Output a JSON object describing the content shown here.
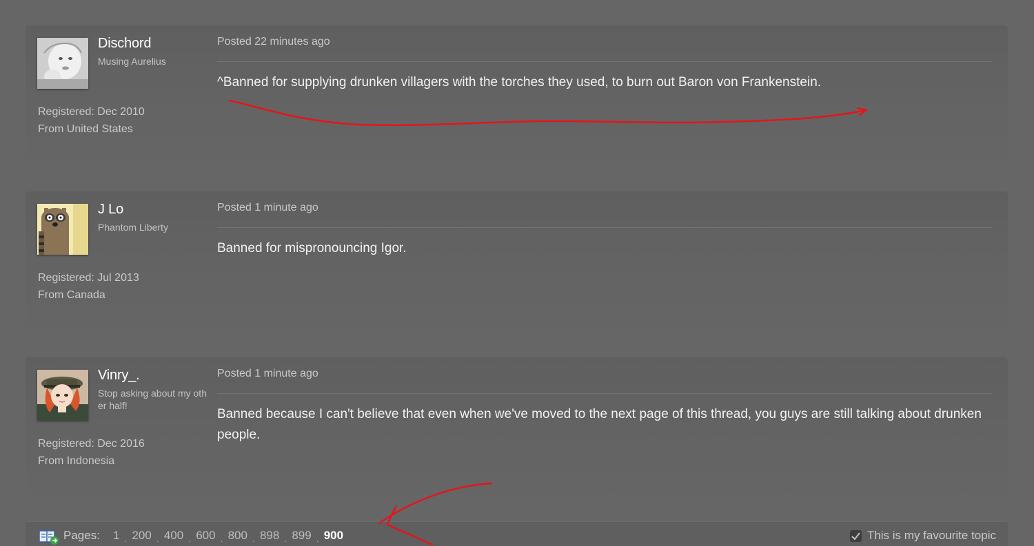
{
  "posts": [
    {
      "username": "Dischord",
      "user_title": "Musing Aurelius",
      "registered": "Registered: Dec 2010",
      "from": "From United States",
      "posted": "Posted 22 minutes ago",
      "content": "^Banned for supplying drunken villagers with the torches they used, to burn out Baron von Frankenstein.",
      "avatar_icon": "baby-photo-avatar"
    },
    {
      "username": "J Lo",
      "user_title": "Phantom Liberty",
      "registered": "Registered: Jul 2013",
      "from": "From Canada",
      "posted": "Posted 1 minute ago",
      "content": "Banned for mispronouncing Igor.",
      "avatar_icon": "raccoon-cartoon-avatar"
    },
    {
      "username": "Vinry_.",
      "user_title": "Stop asking about my other half!",
      "registered": "Registered: Dec 2016",
      "from": "From Indonesia",
      "posted": "Posted 1 minute ago",
      "content": "Banned because I can't believe that even when we've moved to the next page of this thread, you guys are still talking about drunken people.",
      "avatar_icon": "anime-officer-avatar"
    }
  ],
  "pagination": {
    "label": "Pages:",
    "pages": [
      "1",
      "200",
      "400",
      "600",
      "800",
      "898",
      "899",
      "900"
    ],
    "current": "900",
    "separator": ".",
    "icon": "book-arrow-icon"
  },
  "favourite": {
    "label": "This is my favourite topic",
    "checked": true
  },
  "annotation_color": "#e5151c"
}
